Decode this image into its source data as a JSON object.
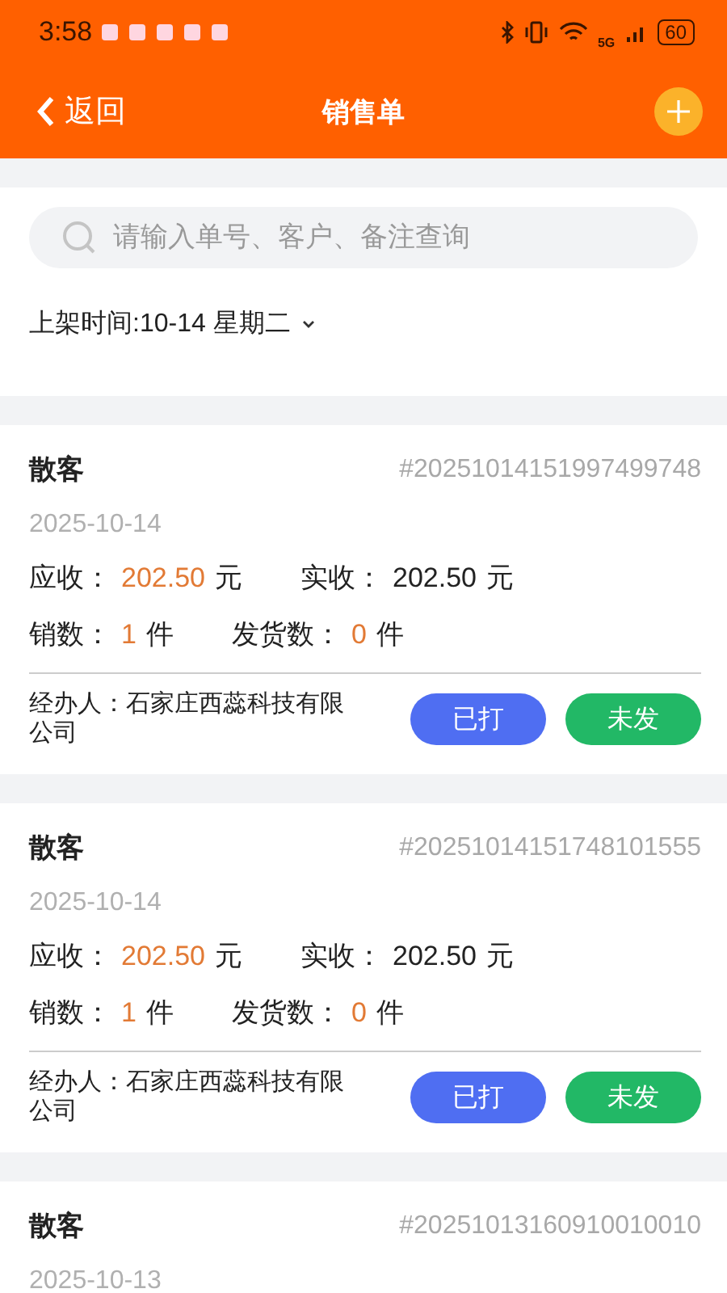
{
  "status_bar": {
    "time": "3:58",
    "network": "5G",
    "battery": "60"
  },
  "header": {
    "back_label": "返回",
    "title": "销售单"
  },
  "search": {
    "placeholder": "请输入单号、客户、备注查询"
  },
  "filter": {
    "label": "上架时间:10-14 星期二"
  },
  "orders": [
    {
      "customer": "散客",
      "order_no": "#20251014151997499748",
      "date": "2025-10-14",
      "receivable_label": "应收：",
      "receivable": "202.50",
      "receivable_unit": "元",
      "received_label": "实收：",
      "received": "202.50",
      "received_unit": "元",
      "sold_label": "销数：",
      "sold": "1",
      "sold_unit": "件",
      "shipped_label": "发货数：",
      "shipped": "0",
      "shipped_unit": "件",
      "handler": "经办人：石家庄西蕊科技有限公司",
      "tags": [
        {
          "label": "已打",
          "color": "#4f6ef2"
        },
        {
          "label": "未发",
          "color": "#22b866"
        }
      ]
    },
    {
      "customer": "散客",
      "order_no": "#20251014151748101555",
      "date": "2025-10-14",
      "receivable_label": "应收：",
      "receivable": "202.50",
      "receivable_unit": "元",
      "received_label": "实收：",
      "received": "202.50",
      "received_unit": "元",
      "sold_label": "销数：",
      "sold": "1",
      "sold_unit": "件",
      "shipped_label": "发货数：",
      "shipped": "0",
      "shipped_unit": "件",
      "handler": "经办人：石家庄西蕊科技有限公司",
      "tags": [
        {
          "label": "已打",
          "color": "#4f6ef2"
        },
        {
          "label": "未发",
          "color": "#22b866"
        }
      ]
    },
    {
      "customer": "散客",
      "order_no": "#20251013160910010010",
      "date": "2025-10-13"
    }
  ]
}
